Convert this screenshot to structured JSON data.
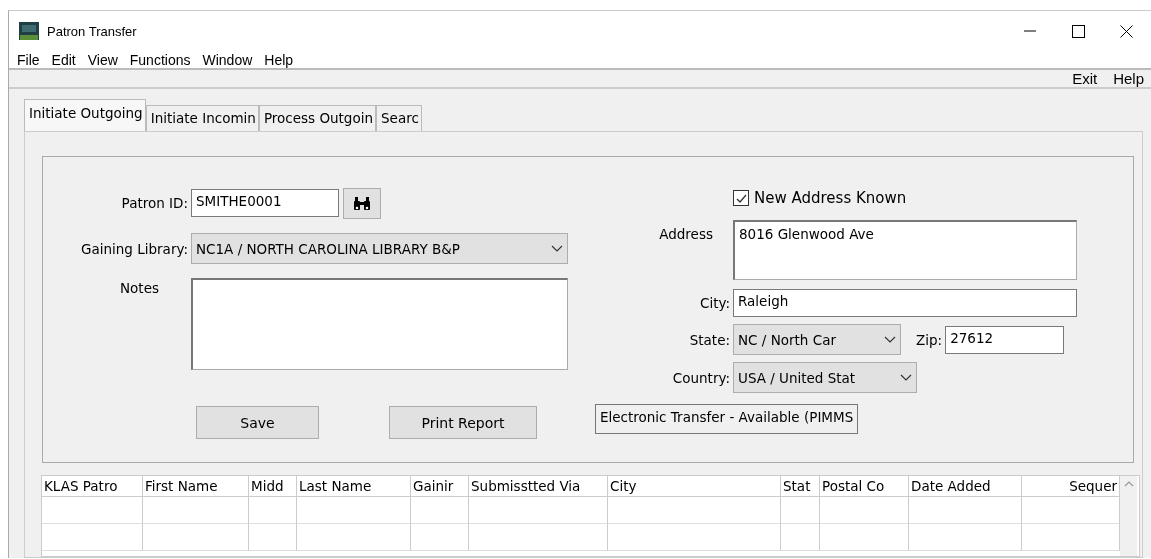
{
  "window": {
    "title": "Patron Transfer"
  },
  "menu": [
    "File",
    "Edit",
    "View",
    "Functions",
    "Window",
    "Help"
  ],
  "toolbar": [
    "Exit",
    "Help"
  ],
  "tabs": [
    {
      "label": "Initiate Outgoing",
      "selected": true
    },
    {
      "label": "Initiate Incomin",
      "selected": false
    },
    {
      "label": "Process Outgoin",
      "selected": false
    },
    {
      "label": "Searc",
      "selected": false
    }
  ],
  "form": {
    "patron_id": {
      "label": "Patron ID:",
      "value": "SMITHE0001"
    },
    "gaining_library": {
      "label": "Gaining Library:",
      "value": "NC1A / NORTH CAROLINA LIBRARY B&P"
    },
    "notes": {
      "label": "Notes"
    },
    "new_address_known": {
      "label": "New Address Known",
      "checked": true
    },
    "address": {
      "label": "Address",
      "value": "8016 Glenwood Ave"
    },
    "city": {
      "label": "City:",
      "value": "Raleigh"
    },
    "state": {
      "label": "State:",
      "value": "NC / North Car"
    },
    "zip": {
      "label": "Zip:",
      "value": "27612"
    },
    "country": {
      "label": "Country:",
      "value": "USA / United Stat"
    }
  },
  "buttons": [
    "Save",
    "Print Report"
  ],
  "status": "Electronic Transfer - Available (PIMMS",
  "table": {
    "columns": [
      "KLAS Patro",
      "First Name",
      "Midd",
      "Last Name",
      "Gainir",
      "Submisstted Via",
      "City",
      "Stat",
      "Postal Co",
      "Date Added",
      "Sequer"
    ]
  }
}
